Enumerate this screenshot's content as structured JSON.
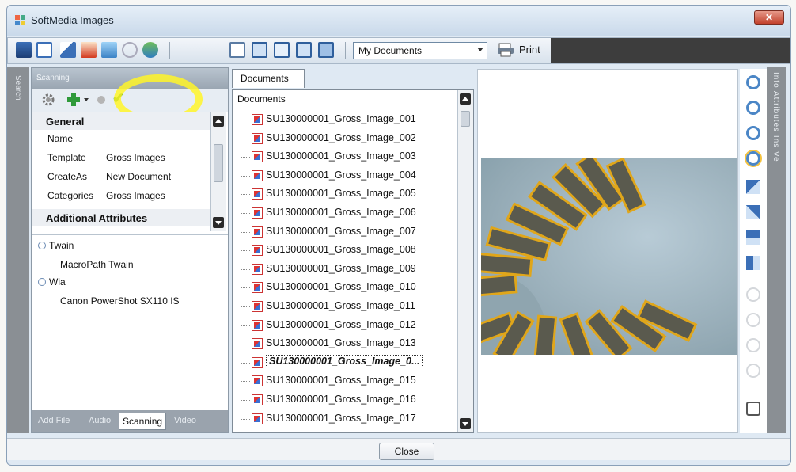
{
  "window": {
    "title": "SoftMedia Images",
    "close_glyph": "✕"
  },
  "toolbar": {
    "document_select_value": "My Documents",
    "print_label": "Print"
  },
  "left_strip": {
    "label": "Search"
  },
  "right_strip": {
    "label": "Info Attributes Ins Ve"
  },
  "scanning_panel": {
    "header": "Scanning",
    "pin_glyph": "⊥",
    "properties": {
      "general_heading": "General",
      "rows": [
        {
          "key": "Name",
          "value": ""
        },
        {
          "key": "Template",
          "value": "Gross Images"
        },
        {
          "key": "CreateAs",
          "value": "New Document"
        },
        {
          "key": "Categories",
          "value": "Gross Images"
        }
      ],
      "additional_heading": "Additional Attributes"
    },
    "tree": {
      "twain": "Twain",
      "twain_child": "MacroPath Twain",
      "wia": "Wia",
      "wia_child": "Canon PowerShot SX110 IS"
    },
    "tabs": [
      "Add File",
      "Audio",
      "Scanning",
      "Video"
    ]
  },
  "documents": {
    "tab_label": "Documents",
    "header": "Documents",
    "items": [
      "SU130000001_Gross_Image_001",
      "SU130000001_Gross_Image_002",
      "SU130000001_Gross_Image_003",
      "SU130000001_Gross_Image_004",
      "SU130000001_Gross_Image_005",
      "SU130000001_Gross_Image_006",
      "SU130000001_Gross_Image_007",
      "SU130000001_Gross_Image_008",
      "SU130000001_Gross_Image_009",
      "SU130000001_Gross_Image_010",
      "SU130000001_Gross_Image_011",
      "SU130000001_Gross_Image_012",
      "SU130000001_Gross_Image_013",
      "SU130000001_Gross_Image_0...",
      "SU130000001_Gross_Image_015",
      "SU130000001_Gross_Image_016",
      "SU130000001_Gross_Image_017"
    ],
    "selected_index": 13
  },
  "footer": {
    "close_label": "Close"
  },
  "colors": {
    "highlight": "#fff528",
    "check": "#1f8a1f",
    "accent": "#4b86c6"
  }
}
